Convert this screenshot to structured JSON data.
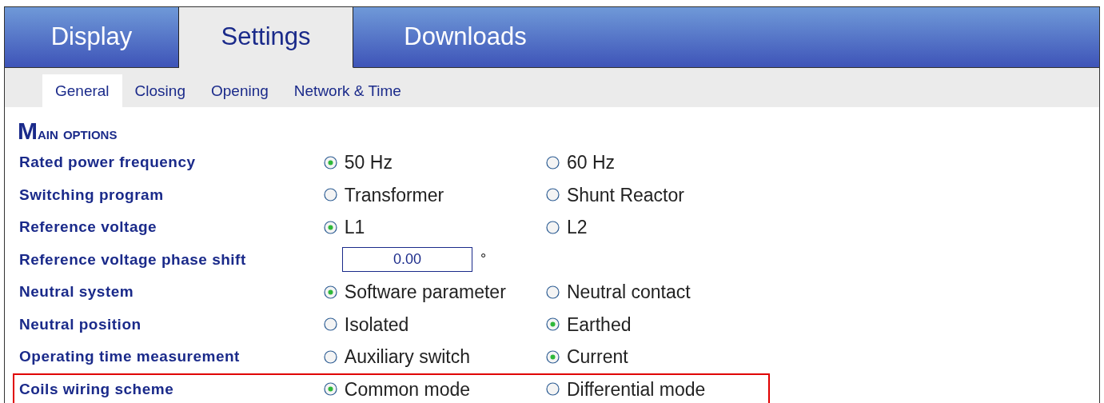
{
  "tabs": [
    {
      "label": "Display",
      "selected": false
    },
    {
      "label": "Settings",
      "selected": true
    },
    {
      "label": "Downloads",
      "selected": false
    }
  ],
  "subtabs": [
    {
      "label": "General",
      "selected": true
    },
    {
      "label": "Closing",
      "selected": false
    },
    {
      "label": "Opening",
      "selected": false
    },
    {
      "label": "Network & Time",
      "selected": false
    }
  ],
  "heading": "Main options",
  "rows": [
    {
      "label": "Rated power frequency",
      "kind": "radio",
      "highlighted": false,
      "options": [
        {
          "label": "50 Hz",
          "selected": true
        },
        {
          "label": "60 Hz",
          "selected": false
        }
      ]
    },
    {
      "label": "Switching program",
      "kind": "radio",
      "highlighted": false,
      "options": [
        {
          "label": "Transformer",
          "selected": false
        },
        {
          "label": "Shunt Reactor",
          "selected": false
        }
      ]
    },
    {
      "label": "Reference voltage",
      "kind": "radio",
      "highlighted": false,
      "options": [
        {
          "label": "L1",
          "selected": true
        },
        {
          "label": "L2",
          "selected": false
        }
      ]
    },
    {
      "label": "Reference voltage phase shift",
      "kind": "number",
      "highlighted": false,
      "value": "0.00",
      "unit": "°"
    },
    {
      "label": "Neutral system",
      "kind": "radio",
      "highlighted": false,
      "options": [
        {
          "label": "Software parameter",
          "selected": true
        },
        {
          "label": "Neutral contact",
          "selected": false
        }
      ]
    },
    {
      "label": "Neutral position",
      "kind": "radio",
      "highlighted": false,
      "options": [
        {
          "label": "Isolated",
          "selected": false
        },
        {
          "label": "Earthed",
          "selected": true
        }
      ]
    },
    {
      "label": "Operating time measurement",
      "kind": "radio",
      "highlighted": false,
      "options": [
        {
          "label": "Auxiliary switch",
          "selected": false
        },
        {
          "label": "Current",
          "selected": true
        }
      ]
    },
    {
      "label": "Coils wiring scheme",
      "kind": "radio",
      "highlighted": true,
      "options": [
        {
          "label": "Common mode",
          "selected": true
        },
        {
          "label": "Differential mode",
          "selected": false
        }
      ]
    }
  ]
}
